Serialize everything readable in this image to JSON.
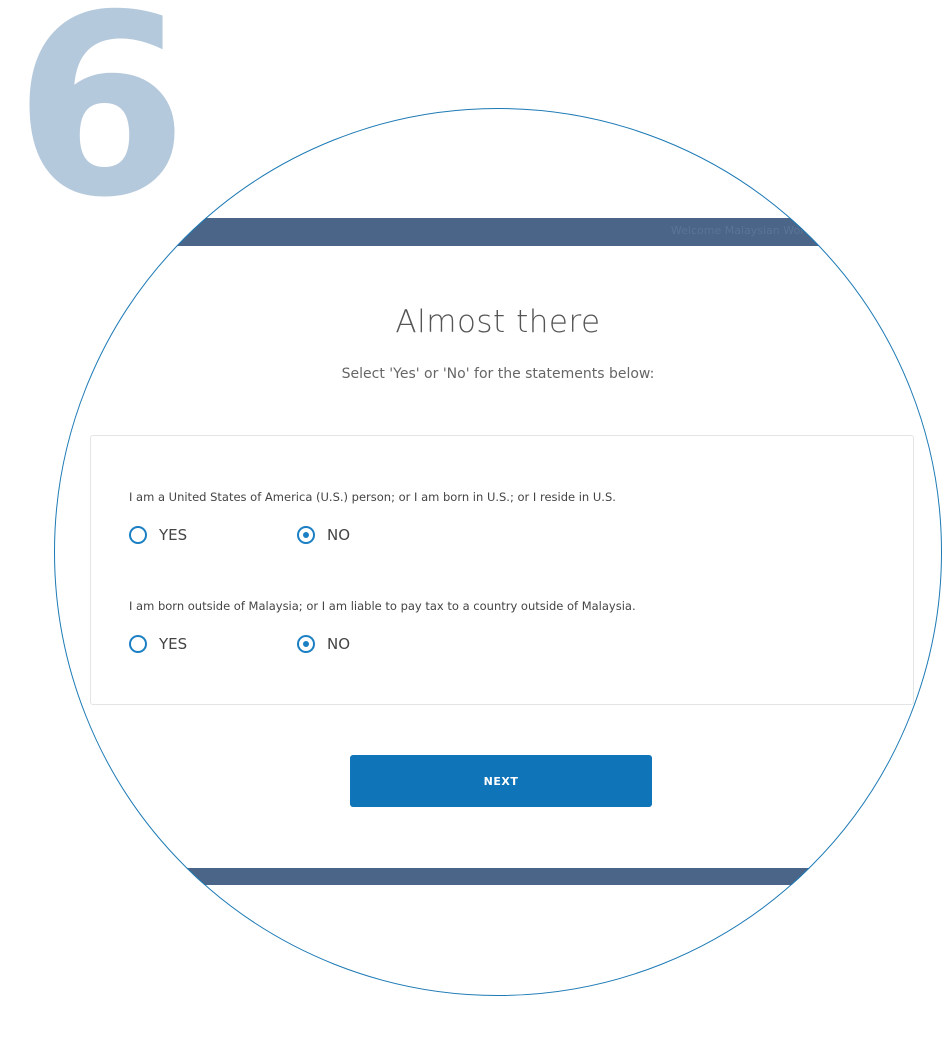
{
  "step": {
    "number": "6"
  },
  "header": {
    "faint_text": "Welcome Malaysian Worker"
  },
  "page": {
    "title": "Almost there",
    "subtitle": "Select 'Yes' or 'No' for the statements below:"
  },
  "questions": [
    {
      "text": "I am a United States of America (U.S.) person; or I am born in U.S.; or I reside in U.S.",
      "options": [
        {
          "label": "YES",
          "selected": false
        },
        {
          "label": "NO",
          "selected": true
        }
      ]
    },
    {
      "text": "I am born outside of Malaysia; or I am liable to pay tax to a country outside of Malaysia.",
      "options": [
        {
          "label": "YES",
          "selected": false
        },
        {
          "label": "NO",
          "selected": true
        }
      ]
    }
  ],
  "actions": {
    "next_label": "NEXT"
  },
  "colors": {
    "step_number": "#b5c9dc",
    "nav_bar": "#4a6587",
    "accent": "#1b7fc4",
    "button": "#0f74b8",
    "circle_outline": "#1d7ab5"
  }
}
